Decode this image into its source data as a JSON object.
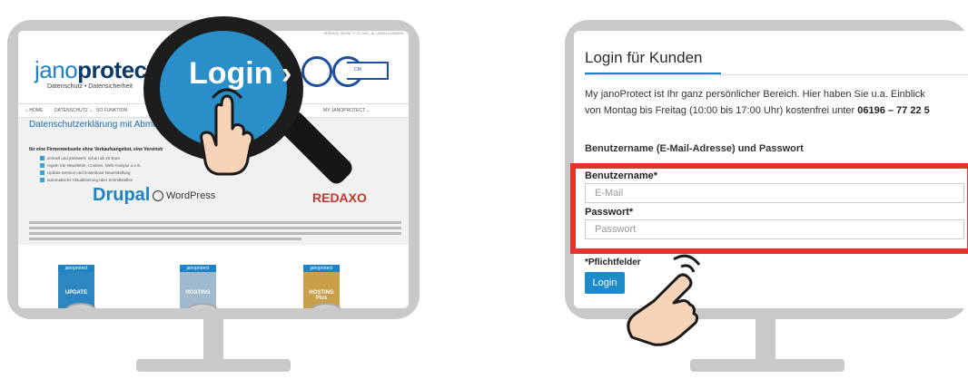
{
  "left_site": {
    "topbar": "SERVICE 06196-77 22 590  |  ▲ LOGIN KUNDEN",
    "logo_light": "jano",
    "logo_bold": "protect",
    "tagline": "Datenschutz • Datensicherheit",
    "nav": [
      "⌂ HOME",
      "DATENSCHUTZ ⌄",
      "SO FUNKTION",
      "MY JANOPROTECT ⌄"
    ],
    "page_title": "Datenschutzerklärung mit Abmahnkoste",
    "subtitle": "für eine Firmenwebseite ohne Verkaufsangebot, eine Vereinsh",
    "checks": [
      "schnell und preiswert: schon ab 20 Euro",
      "regeln Sie Newsletter, Cookies, Web-Analyse u.v.m.",
      "Update-Service und kostenlose Neuerstellung",
      "automatische Aktualisierung über Schnittstellen"
    ],
    "brands": [
      "Drupal",
      "WordPress",
      "REDAXO"
    ],
    "products": [
      {
        "brand": "janoprotect",
        "name": "UPDATE"
      },
      {
        "brand": "janoprotect",
        "name": "HOSTING"
      },
      {
        "brand": "janoprotect",
        "name": "HOSTING Plus"
      }
    ],
    "magnifier_text": "Login ›",
    "seal_label": "CM"
  },
  "right_site": {
    "title": "Login für Kunden",
    "intro_line1": "My janoProtect ist Ihr ganz persönlicher Bereich. Hier haben Sie u.a. Einblick",
    "intro_line2_prefix": "von Montag bis Freitag (10:00 bis 17:00 Uhr) kostenfrei unter ",
    "intro_phone": "06196 – 77 22 5",
    "section_heading": "Benutzername (E-Mail-Adresse) und Passwort",
    "username_label": "Benutzername*",
    "username_placeholder": "E-Mail",
    "password_label": "Passwort*",
    "password_placeholder": "Passwort",
    "required_note": "*Pflichtfelder",
    "login_button": "Login"
  },
  "colors": {
    "frame": "#c9c9c9",
    "accent_blue": "#1d83c4",
    "highlight_red": "#e2342d",
    "magnifier_lens": "#2a8fc8"
  },
  "icons": [
    "magnifier-icon",
    "pointing-hand-icon",
    "checkbox-icon",
    "home-icon"
  ]
}
